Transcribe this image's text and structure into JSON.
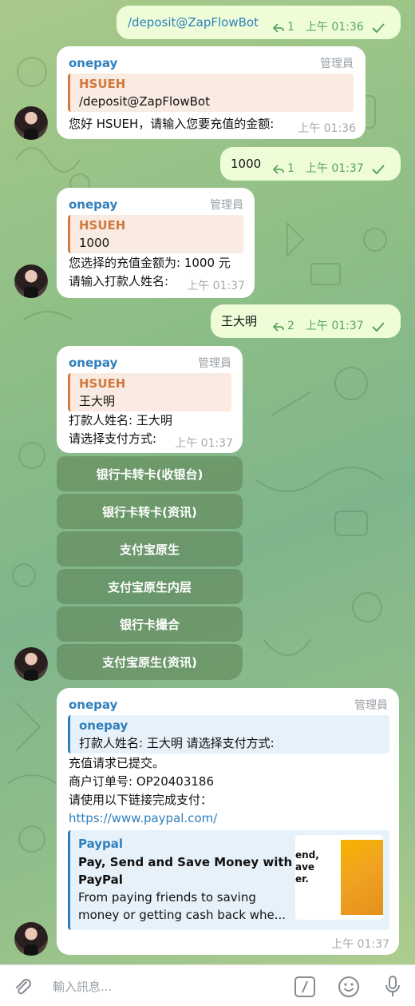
{
  "colors": {
    "accent": "#2f7fbd",
    "outgoing_bubble": "#eefdd8",
    "quote_accent": "#d2793e",
    "read_check": "#58a45a"
  },
  "messages": {
    "m1": {
      "text": "/deposit@ZapFlowBot",
      "replies": "1",
      "time": "上午 01:36"
    },
    "m2": {
      "sender": "onepay",
      "role": "管理員",
      "quote_name": "HSUEH",
      "quote_text": "/deposit@ZapFlowBot",
      "text": "您好 HSUEH，请输入您要充值的金额:",
      "time": "上午 01:36"
    },
    "m3": {
      "text": "1000",
      "replies": "1",
      "time": "上午 01:37"
    },
    "m4": {
      "sender": "onepay",
      "role": "管理員",
      "quote_name": "HSUEH",
      "quote_text": "1000",
      "line1": "您选择的充值金额为: 1000 元",
      "line2": "请输入打款人姓名:",
      "time": "上午 01:37"
    },
    "m5": {
      "text": "王大明",
      "replies": "2",
      "time": "上午 01:37"
    },
    "m6": {
      "sender": "onepay",
      "role": "管理員",
      "quote_name": "HSUEH",
      "quote_text": "王大明",
      "line1": "打款人姓名: 王大明",
      "line2": "请选择支付方式:",
      "time": "上午 01:37",
      "buttons": [
        "银行卡转卡(收银台)",
        "银行卡转卡(资讯)",
        "支付宝原生",
        "支付宝原生内层",
        "银行卡撮合",
        "支付宝原生(资讯)"
      ]
    },
    "m7": {
      "sender": "onepay",
      "role": "管理員",
      "quote_name": "onepay",
      "quote_text": "打款人姓名: 王大明 请选择支付方式:",
      "line1": "充值请求已提交。",
      "line2": "商户订单号: OP20403186",
      "line3": "请使用以下链接完成支付：",
      "link": "https://www.paypal.com/",
      "preview": {
        "site": "Paypal",
        "title1": "Pay, Send and Save Money with",
        "title2": "PayPal",
        "desc1": "From paying friends to saving",
        "desc2": "money or getting cash back whe...",
        "thumb_text": "end,\nave\ner."
      },
      "time": "上午 01:37"
    }
  },
  "input": {
    "placeholder": "輸入訊息..."
  }
}
